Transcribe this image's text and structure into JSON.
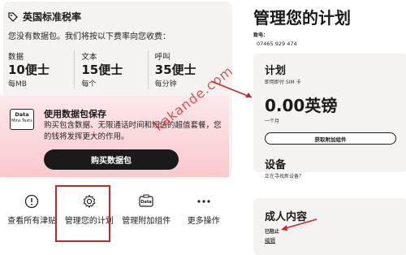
{
  "plan_card": {
    "title": "英国标准税率",
    "subtitle": "您没有数据包。我们将按以下费率向您收费：",
    "rates": [
      {
        "label": "数据",
        "value": "10便士",
        "unit": "每MB"
      },
      {
        "label": "文本",
        "value": "15便士",
        "unit": "每个"
      },
      {
        "label": "呼叫",
        "value": "35便士",
        "unit": "每分钟"
      }
    ]
  },
  "promo": {
    "icon_top": "Data",
    "icon_bottom": "Mins Texts",
    "title": "使用数据包保存",
    "description": "购买包含数据、无限通话时间和短信的超值套餐，您的钱将发挥更大的作用。",
    "button": "购买数据包"
  },
  "actions": [
    {
      "label": "查看所有津贴",
      "icon": "info-icon"
    },
    {
      "label": "管理您的计划",
      "icon": "gear-icon"
    },
    {
      "label": "管理附加组件",
      "icon": "data-addon-icon"
    },
    {
      "label": "更多操作",
      "icon": "more-dots-icon"
    }
  ],
  "right": {
    "title": "管理您的计划",
    "phone_label": "致电：",
    "phone": "07465 929 474",
    "plan_title": "计划",
    "plan_sub": "即用即付 SIM 卡",
    "price": "0.00英镑",
    "period": "一个月",
    "addon_button": "获取附加组件",
    "devices_title": "设备",
    "devices_sub": "正在寻找新设备？",
    "adult_title": "成人内容",
    "adult_status": "已阻止",
    "adult_edit": "编辑"
  },
  "watermark": "kakande.com",
  "colors": {
    "accent_red": "#d02424",
    "card_bg": "#f4f3f2",
    "dark": "#1a1a1a"
  }
}
